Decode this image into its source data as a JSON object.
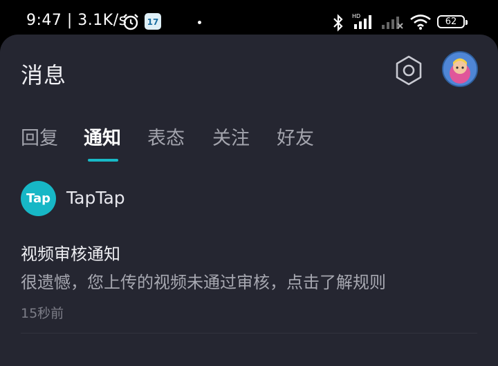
{
  "status_bar": {
    "time_speed": "9:47 | 3.1K/s",
    "calendar_day": "17",
    "hd_label": "HD",
    "battery": "62",
    "icons": [
      "alarm-icon",
      "calendar-icon",
      "bluetooth-icon",
      "signal-icon",
      "signal-off-icon",
      "wifi-icon",
      "battery-icon"
    ]
  },
  "header": {
    "title": "消息",
    "settings_icon": "settings-hexagon-icon",
    "avatar_icon": "user-avatar"
  },
  "tabs": [
    {
      "label": "回复",
      "active": false
    },
    {
      "label": "通知",
      "active": true
    },
    {
      "label": "表态",
      "active": false
    },
    {
      "label": "关注",
      "active": false
    },
    {
      "label": "好友",
      "active": false
    }
  ],
  "notification": {
    "app_logo_text": "Tap",
    "app_name": "TapTap",
    "title": "视频审核通知",
    "body": "很遗憾，您上传的视频未通过审核，点击了解规则",
    "time": "15秒前"
  },
  "colors": {
    "background": "#252631",
    "accent": "#18b9c6",
    "text_primary": "#eeeef2",
    "text_secondary": "#a7a8b1"
  }
}
